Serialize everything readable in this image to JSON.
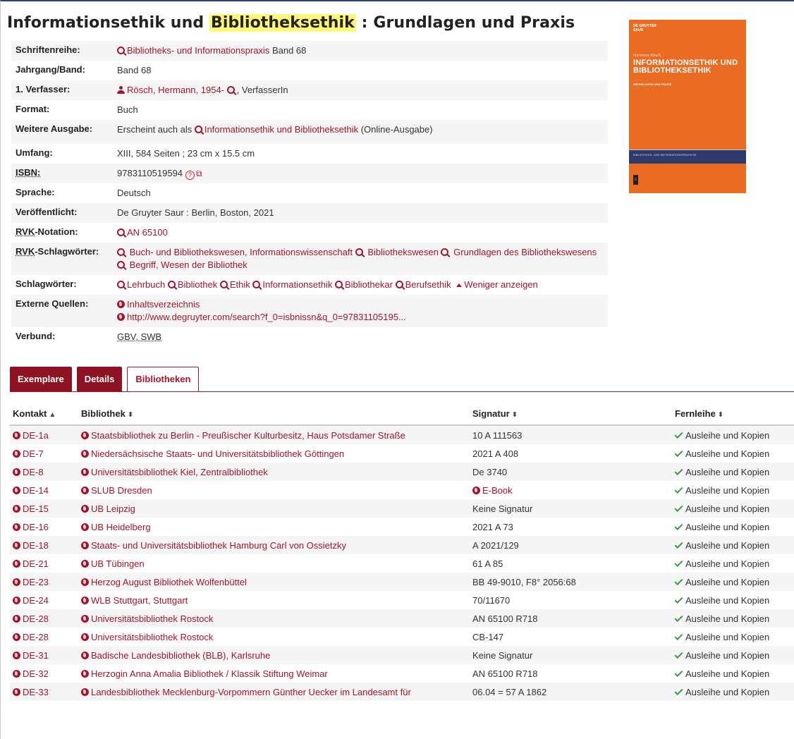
{
  "title": {
    "part1": "Informationsethik und ",
    "highlight": "Bibliotheksethik",
    "part2": " : Grundlagen und Praxis"
  },
  "meta": {
    "schriftenreihe": {
      "label": "Schriftenreihe:",
      "link": "Bibliotheks- und Informationspraxis",
      "suffix": " Band 68"
    },
    "jahrgang": {
      "label": "Jahrgang/Band:",
      "value": "Band 68"
    },
    "verfasser": {
      "label": "1. Verfasser:",
      "link": "Rösch, Hermann, 1954-",
      "suffix": ", VerfasserIn"
    },
    "format": {
      "label": "Format:",
      "value": "Buch"
    },
    "weitere": {
      "label": "Weitere Ausgabe:",
      "prefix": "Erscheint auch als ",
      "link": "Informationsethik und Bibliotheksethik",
      "suffix": " (Online-Ausgabe)"
    },
    "umfang": {
      "label": "Umfang:",
      "value": "XIII, 584 Seiten ; 23 cm x 15.5 cm"
    },
    "isbn": {
      "label": "ISBN:",
      "value": "9783110519594"
    },
    "sprache": {
      "label": "Sprache:",
      "value": "Deutsch"
    },
    "veroeffentlicht": {
      "label": "Veröffentlicht:",
      "value": "De Gruyter Saur : Berlin, Boston, 2021"
    },
    "rvk_notation": {
      "label_a": "RVK",
      "label_b": "-Notation:",
      "link": "AN 65100"
    },
    "rvk_schlag": {
      "label_a": "RVK",
      "label_b": "-Schlagwörter:",
      "links": [
        "Buch- und Bibliothekswesen, Informationswissenschaft",
        "Bibliothekswesen",
        "Grundlagen des Bibliothekswesens",
        "Begriff, Wesen der Bibliothek"
      ]
    },
    "schlagwoerter": {
      "label": "Schlagwörter:",
      "links": [
        "Lehrbuch",
        "Bibliothek",
        "Ethik",
        "Informationsethik",
        "Bibliothekar",
        "Berufsethik"
      ],
      "less": "Weniger anzeigen"
    },
    "externe": {
      "label": "Externe Quellen:",
      "links": [
        "Inhaltsverzeichnis",
        "http://www.degruyter.com/search?f_0=isbnissn&q_0=97831105195..."
      ]
    },
    "verbund": {
      "label": "Verbund:",
      "value": "GBV, SWB"
    }
  },
  "cover": {
    "publisher": "DE GRUYTER",
    "publisher_sub": "SAUR",
    "author": "Hermann Rösch",
    "title": "INFORMATIONSETHIK UND BIBLIOTHEKSETHIK",
    "subtitle": "GRUNDLAGEN UND PRAXIS",
    "series": "BIBLIOTHEKS- UND INFORMATIONSPRAXIS 68",
    "logo": "G",
    "color": "#ea6c23"
  },
  "tabs": [
    {
      "label": "Exemplare"
    },
    {
      "label": "Details"
    },
    {
      "label": "Bibliotheken"
    }
  ],
  "table": {
    "headers": {
      "kontakt": "Kontakt",
      "bibliothek": "Bibliothek",
      "signatur": "Signatur",
      "fernleihe": "Fernleihe"
    },
    "rows": [
      {
        "kontakt": "DE-1a",
        "bibliothek": "Staatsbibliothek zu Berlin - Preußischer Kulturbesitz, Haus Potsdamer Straße",
        "signatur": "10 A 111563",
        "fernleihe": "Ausleihe und Kopien"
      },
      {
        "kontakt": "DE-7",
        "bibliothek": "Niedersächsische Staats- und Universitätsbibliothek Göttingen",
        "signatur": "2021 A 408",
        "fernleihe": "Ausleihe und Kopien"
      },
      {
        "kontakt": "DE-8",
        "bibliothek": "Universitätsbibliothek Kiel, Zentralbibliothek",
        "signatur": "De 3740",
        "fernleihe": "Ausleihe und Kopien"
      },
      {
        "kontakt": "DE-14",
        "bibliothek": "SLUB Dresden",
        "signatur": "E-Book",
        "fernleihe": "Ausleihe und Kopien"
      },
      {
        "kontakt": "DE-15",
        "bibliothek": "UB Leipzig",
        "signatur": "Keine Signatur",
        "fernleihe": "Ausleihe und Kopien"
      },
      {
        "kontakt": "DE-16",
        "bibliothek": "UB Heidelberg",
        "signatur": "2021 A 73",
        "fernleihe": "Ausleihe und Kopien"
      },
      {
        "kontakt": "DE-18",
        "bibliothek": "Staats- und Universitätsbibliothek Hamburg Carl von Ossietzky",
        "signatur": "A 2021/129",
        "fernleihe": "Ausleihe und Kopien"
      },
      {
        "kontakt": "DE-21",
        "bibliothek": "UB Tübingen",
        "signatur": "61 A 85",
        "fernleihe": "Ausleihe und Kopien"
      },
      {
        "kontakt": "DE-23",
        "bibliothek": "Herzog August Bibliothek Wolfenbüttel",
        "signatur": "BB 49-9010, F8° 2056:68",
        "fernleihe": "Ausleihe und Kopien"
      },
      {
        "kontakt": "DE-24",
        "bibliothek": "WLB Stuttgart, Stuttgart",
        "signatur": "70/11670",
        "fernleihe": "Ausleihe und Kopien"
      },
      {
        "kontakt": "DE-28",
        "bibliothek": "Universitätsbibliothek Rostock",
        "signatur": "AN 65100 R718",
        "fernleihe": "Ausleihe und Kopien"
      },
      {
        "kontakt": "DE-28",
        "bibliothek": "Universitätsbibliothek Rostock",
        "signatur": "CB-147",
        "fernleihe": "Ausleihe und Kopien"
      },
      {
        "kontakt": "DE-31",
        "bibliothek": "Badische Landesbibliothek (BLB), Karlsruhe",
        "signatur": "Keine Signatur",
        "fernleihe": "Ausleihe und Kopien"
      },
      {
        "kontakt": "DE-32",
        "bibliothek": "Herzogin Anna Amalia Bibliothek / Klassik Stiftung Weimar",
        "signatur": "AN 65100 R718",
        "fernleihe": "Ausleihe und Kopien"
      },
      {
        "kontakt": "DE-33",
        "bibliothek": "Landesbibliothek Mecklenburg-Vorpommern Günther Uecker im Landesamt für",
        "signatur": "06.04 = 57 A 1862",
        "fernleihe": "Ausleihe und Kopien"
      }
    ]
  }
}
